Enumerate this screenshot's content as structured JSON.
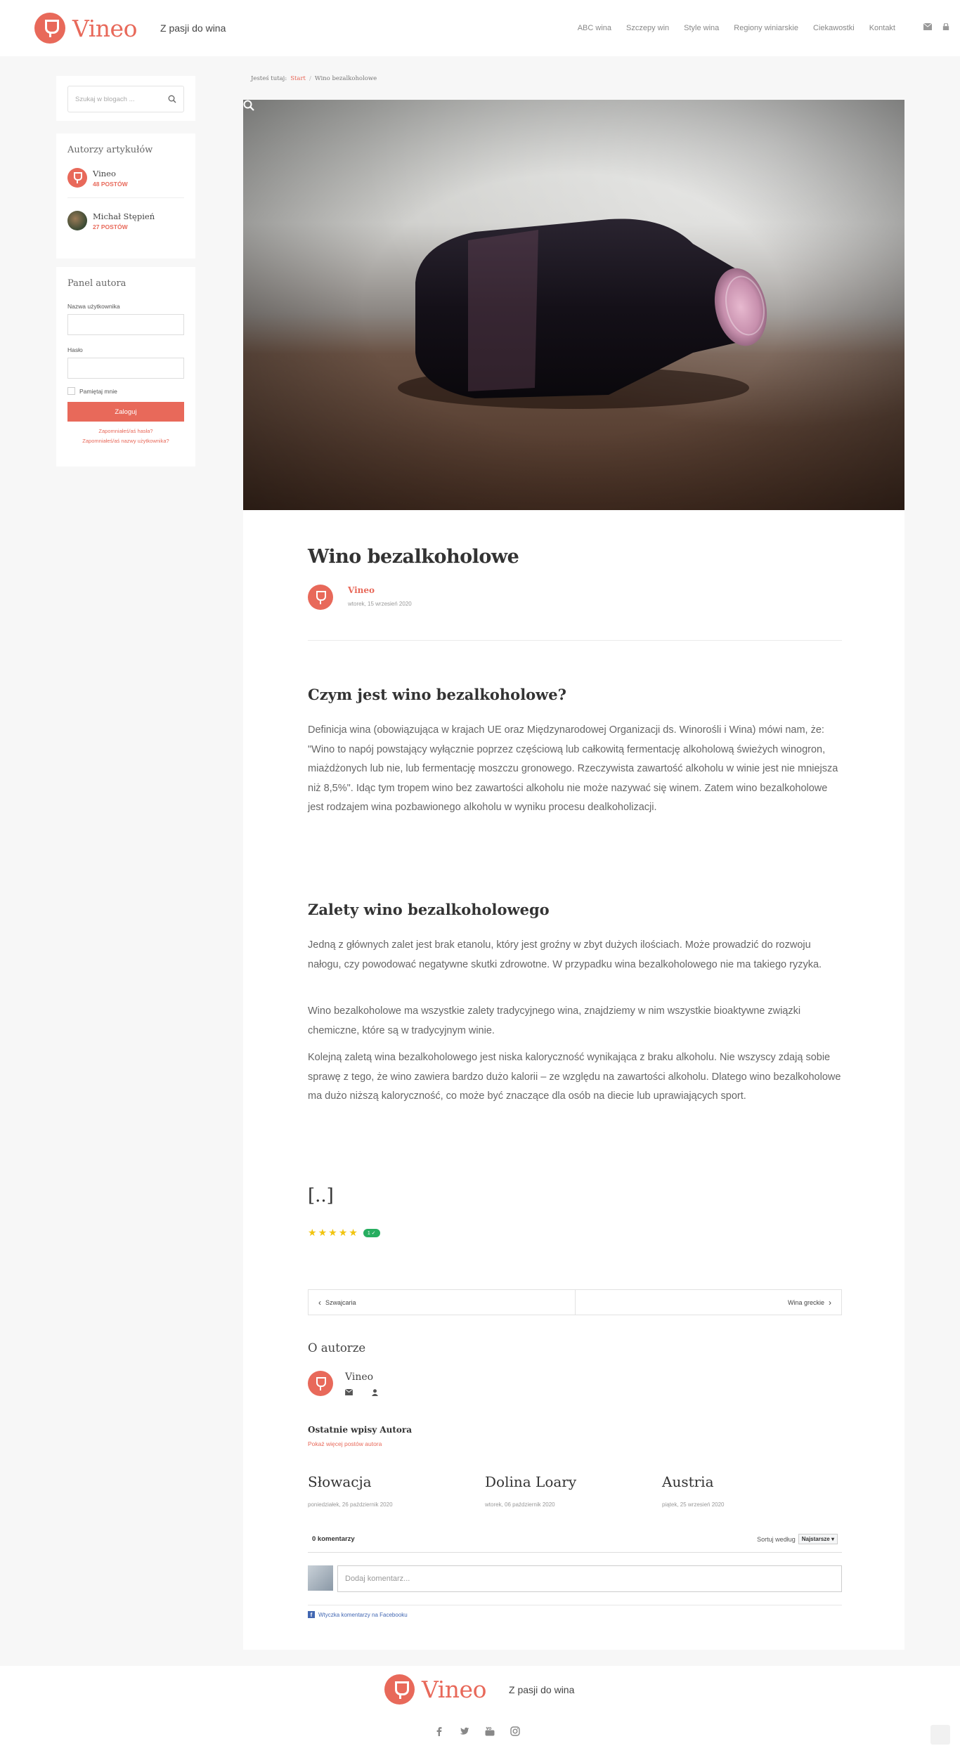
{
  "header": {
    "brand": "Vineo",
    "tagline": "Z pasji do wina",
    "nav": [
      "ABC wina",
      "Szczepy win",
      "Style wina",
      "Regiony winiarskie",
      "Ciekawostki",
      "Kontakt"
    ],
    "icons": [
      "envelope-icon",
      "lock-icon"
    ]
  },
  "sidebar": {
    "search_placeholder": "Szukaj w blogach ...",
    "authors_title": "Autorzy artykułów",
    "authors": [
      {
        "name": "Vineo",
        "posts": "48 POSTÓW"
      },
      {
        "name": "Michał Stępień",
        "posts": "27 POSTÓW"
      }
    ],
    "panel_title": "Panel autora",
    "username_label": "Nazwa użytkownika",
    "password_label": "Hasło",
    "remember_label": "Pamiętaj mnie",
    "login_button": "Zaloguj",
    "forgot_password": "Zapomniałeś/aś hasła?",
    "forgot_username": "Zapomniałeś/aś nazwy użytkownika?"
  },
  "breadcrumb": {
    "prefix": "Jesteś tutaj:",
    "home": "Start",
    "separator": "/",
    "current": "Wino bezalkoholowe"
  },
  "article": {
    "title": "Wino bezalkoholowe",
    "author": "Vineo",
    "date": "wtorek, 15 wrzesień 2020",
    "sections": [
      {
        "heading": "Czym jest wino bezalkoholowe?",
        "paragraphs": [
          "Definicja wina (obowiązująca w krajach UE oraz Międzynarodowej Organizacji ds. Winorośli i Wina) mówi nam, że: \"Wino to napój powstający wyłącznie poprzez częściową lub całkowitą fermentację alkoholową świeżych winogron, miażdżonych lub nie, lub fermentację moszczu gronowego. Rzeczywista zawartość alkoholu w winie jest nie mniejsza niż 8,5%\". Idąc tym tropem wino bez zawartości alkoholu nie może nazywać się winem. Zatem wino bezalkoholowe jest rodzajem wina pozbawionego alkoholu w wyniku procesu dealkoholizacji."
        ]
      },
      {
        "heading": "Zalety wino bezalkoholowego",
        "paragraphs": [
          "Jedną z głównych zalet jest brak etanolu, który jest groźny w zbyt dużych ilościach. Może prowadzić do rozwoju nałogu, czy powodować negatywne skutki zdrowotne. W przypadku wina bezalkoholowego nie ma takiego ryzyka.",
          "Wino bezalkoholowe ma wszystkie zalety tradycyjnego wina, znajdziemy w nim wszystkie bioaktywne związki chemiczne, które są w tradycyjnym winie.",
          "Kolejną zaletą wina bezalkoholowego jest niska kaloryczność wynikająca z braku alkoholu. Nie wszyscy zdają sobie sprawę z tego, że wino zawiera bardzo dużo kalorii – ze względu na zawartości alkoholu. Dlatego wino bezalkoholowe ma dużo niższą kaloryczność, co może być znaczące dla osób na diecie lub uprawiających sport."
        ]
      }
    ],
    "ellipsis": "[..]",
    "rating": {
      "stars": 5,
      "votes": "1 ✓"
    },
    "prev": "Szwajcaria",
    "next": "Wina greckie",
    "about_title": "O autorze",
    "about_name": "Vineo",
    "latest_title": "Ostatnie wpisy Autora",
    "latest_more": "Pokaż więcej postów autora",
    "latest_posts": [
      {
        "title": "Słowacja",
        "date": "poniedziałek, 26 październik 2020"
      },
      {
        "title": "Dolina Loary",
        "date": "wtorek, 06 październik 2020"
      },
      {
        "title": "Austria",
        "date": "piątek, 25 wrzesień 2020"
      }
    ]
  },
  "comments": {
    "count": "0 komentarzy",
    "sort_label": "Sortuj według",
    "sort_value": "Najstarsze",
    "placeholder": "Dodaj komentarz...",
    "plugin": "Wtyczka komentarzy na Facebooku"
  },
  "footer": {
    "brand": "Vineo",
    "tagline": "Z pasji do wina",
    "social": [
      "facebook-icon",
      "twitter-icon",
      "youtube-icon",
      "instagram-icon"
    ]
  },
  "colors": {
    "accent": "#e8695a",
    "rating": "#f1c40f",
    "badge": "#27ae60",
    "facebook": "#4267b2"
  }
}
